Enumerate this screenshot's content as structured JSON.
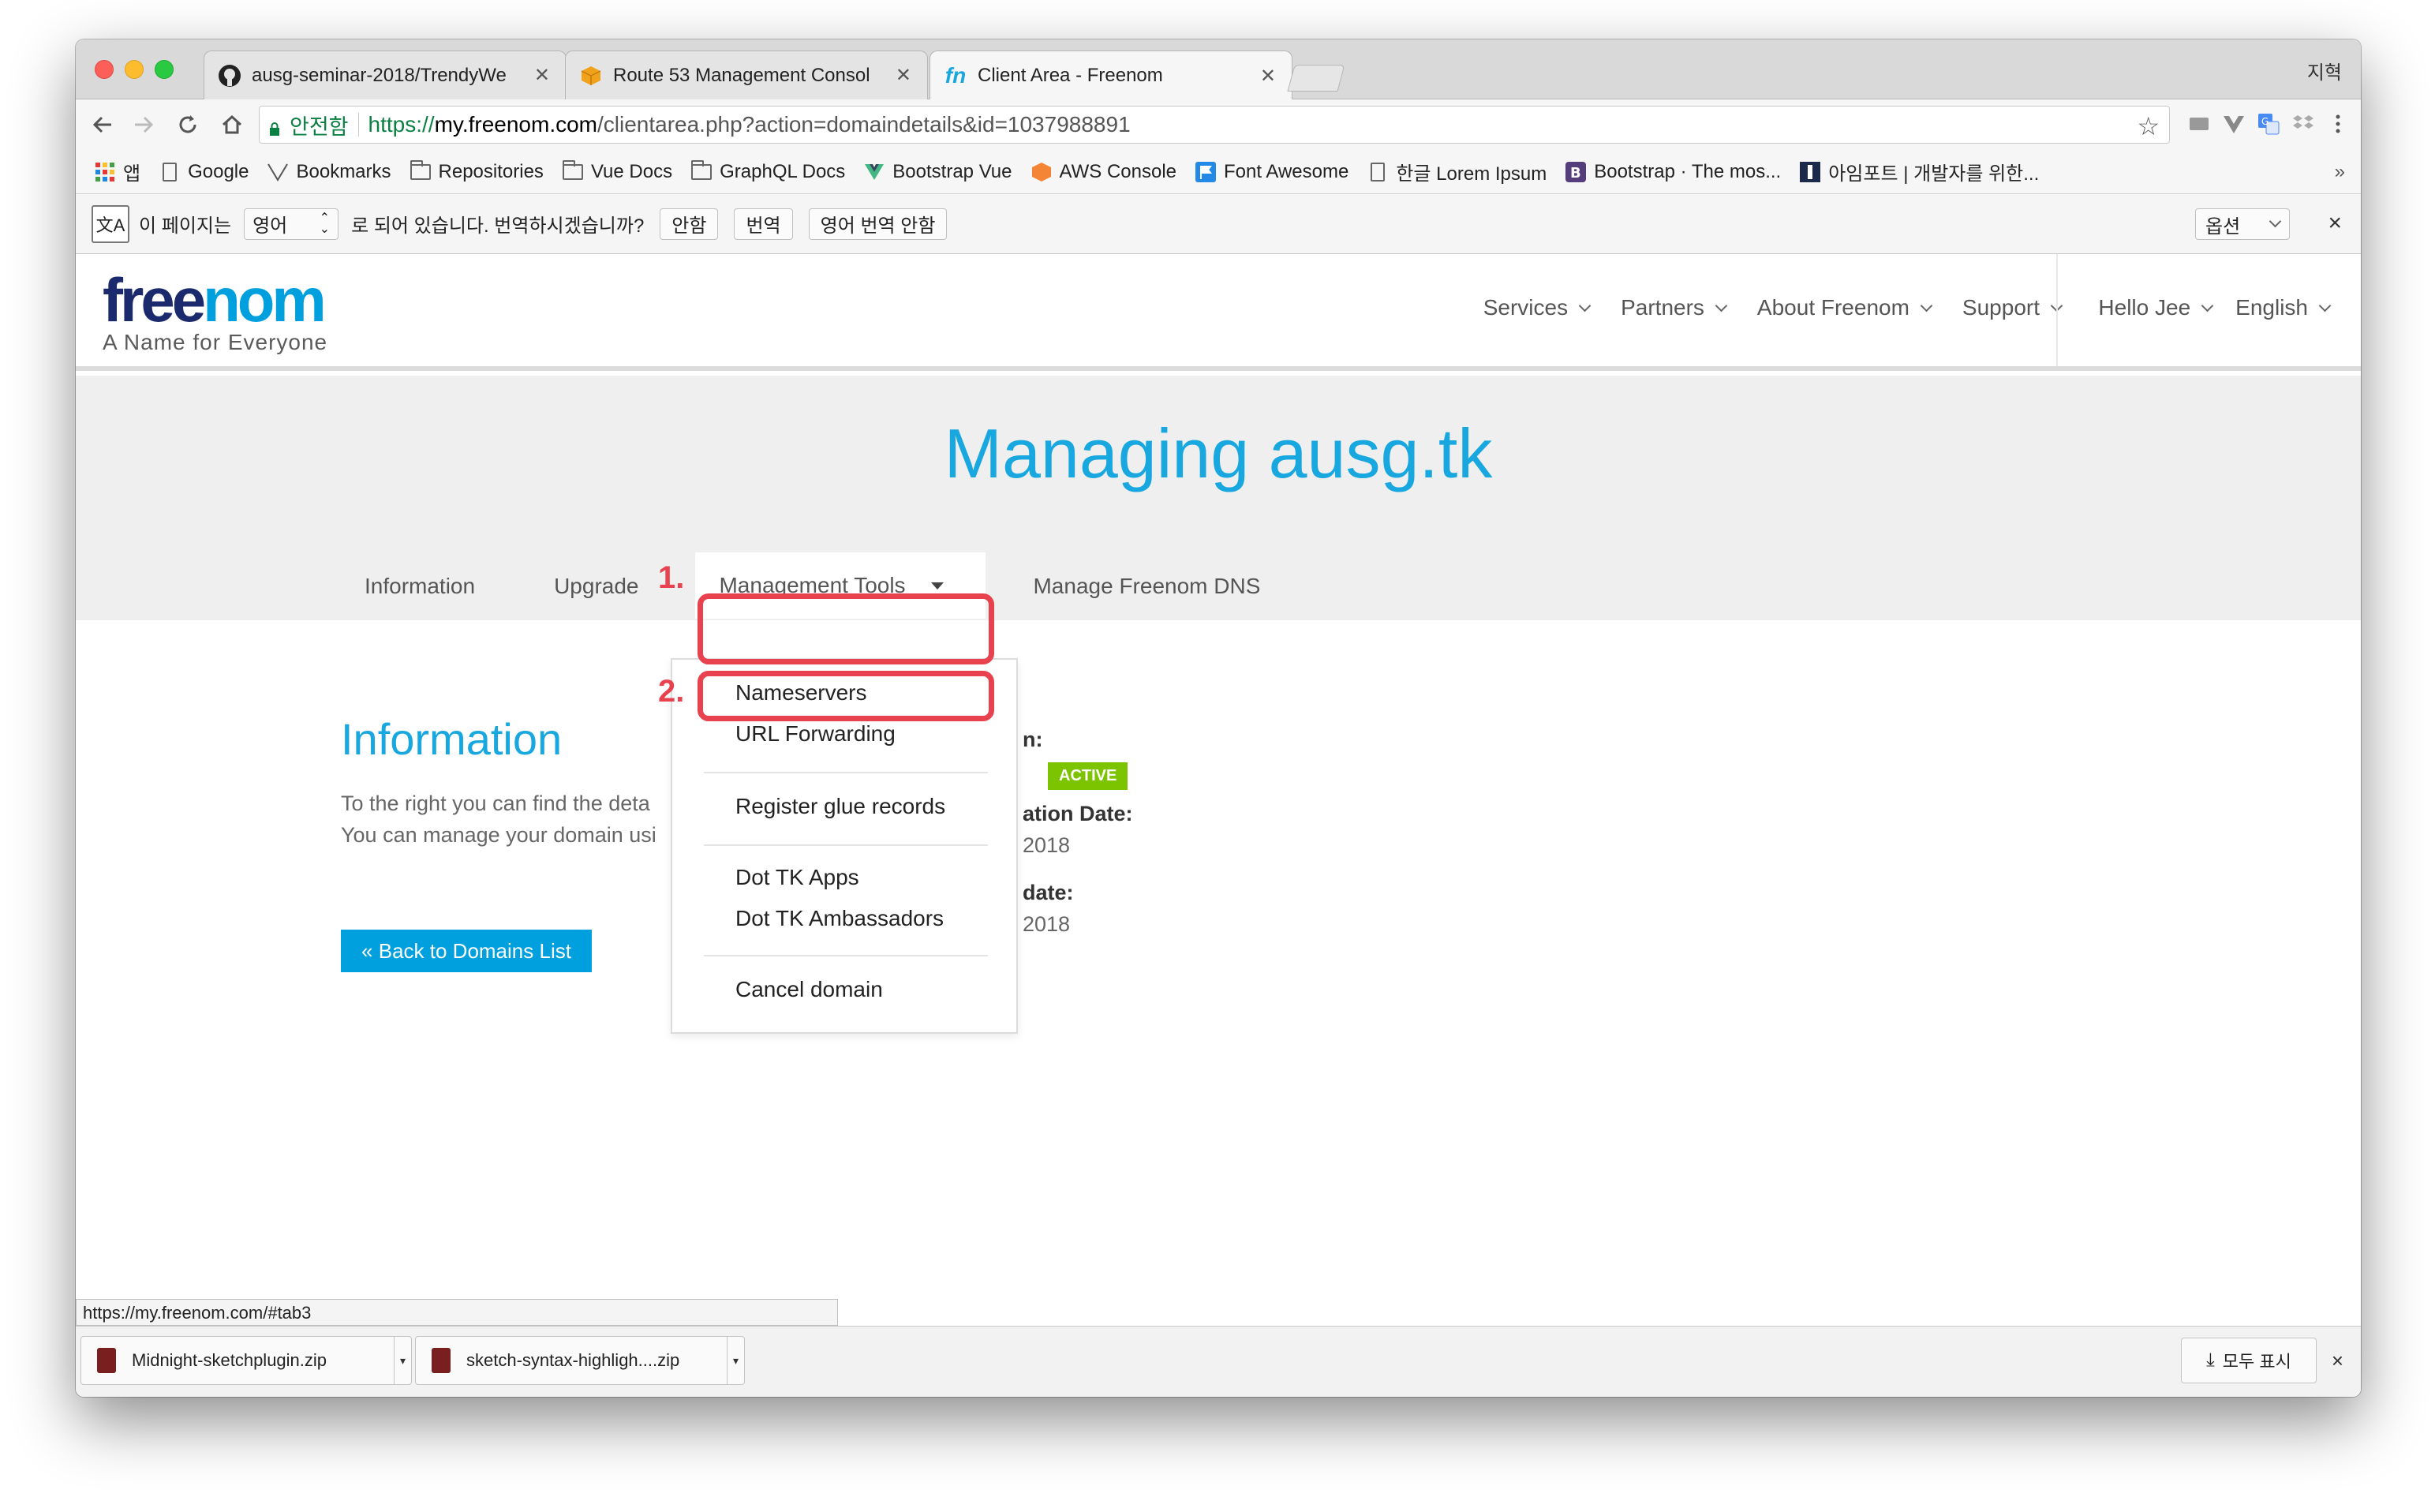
{
  "browser": {
    "tabs": [
      {
        "title": "ausg-seminar-2018/TrendyWe",
        "icon": "github-icon"
      },
      {
        "title": "Route 53 Management Consol",
        "icon": "aws-icon"
      },
      {
        "title": "Client Area - Freenom",
        "icon": "freenom-icon",
        "active": true
      }
    ],
    "profile": "지혁",
    "secure_label": "안전함",
    "url_scheme": "https://",
    "url_host": "my.freenom.com",
    "url_path": "/clientarea.php?action=domaindetails&id=1037988891"
  },
  "bookmarks": [
    {
      "label": "앱",
      "icon": "apps-icon"
    },
    {
      "label": "Google",
      "icon": "page-icon"
    },
    {
      "label": "Bookmarks",
      "icon": "vue-icon"
    },
    {
      "label": "Repositories",
      "icon": "folder-icon"
    },
    {
      "label": "Vue Docs",
      "icon": "folder-icon"
    },
    {
      "label": "GraphQL Docs",
      "icon": "folder-icon"
    },
    {
      "label": "Bootstrap Vue",
      "icon": "vue-icon"
    },
    {
      "label": "AWS Console",
      "icon": "aws-icon"
    },
    {
      "label": "Font Awesome",
      "icon": "flag-icon"
    },
    {
      "label": "한글 Lorem Ipsum",
      "icon": "page-icon"
    },
    {
      "label": "Bootstrap · The mos...",
      "icon": "bootstrap-icon"
    },
    {
      "label": "아임포트 | 개발자를 위한...",
      "icon": "iamport-icon"
    }
  ],
  "bookmarks_more": "»",
  "translate": {
    "prefix": "이 페이지는",
    "language": "영어",
    "question": "로 되어 있습니다. 번역하시겠습니까?",
    "no_button": "안함",
    "translate_button": "번역",
    "never_button": "영어 번역 안함",
    "options": "옵션"
  },
  "site": {
    "logo_free": "free",
    "logo_nom": "nom",
    "tagline": "A Name for Everyone",
    "nav": [
      "Services",
      "Partners",
      "About Freenom",
      "Support"
    ],
    "user_nav": [
      "Hello Jee",
      "English"
    ],
    "page_title": "Managing ausg.tk",
    "subnav": {
      "information": "Information",
      "upgrade": "Upgrade",
      "management_tools": "Management Tools",
      "manage_dns": "Manage Freenom DNS"
    },
    "dropdown": [
      "Nameservers",
      "URL Forwarding",
      "Register glue records",
      "Dot TK Apps",
      "Dot TK Ambassadors",
      "Cancel domain"
    ],
    "info_title": "Information",
    "info_text_line1": "To the right you can find the deta",
    "info_text_line2": "You can manage your domain usi",
    "back_button": "« Back to Domains List",
    "right_col": {
      "label1": "n:",
      "status": "ACTIVE",
      "label2": "ation Date:",
      "value2": "2018",
      "label3": "date:",
      "value3": "2018"
    }
  },
  "annotations": {
    "step1": "1.",
    "step2": "2.",
    "color": "#e8424e"
  },
  "status_url": "https://my.freenom.com/#tab3",
  "downloads": {
    "items": [
      "Midnight-sketchplugin.zip",
      "sketch-syntax-highligh....zip"
    ],
    "show_all": "모두 표시"
  },
  "colors": {
    "brand_blue": "#19a7e0",
    "brand_navy": "#1a2a6c",
    "active_green": "#7cc400"
  }
}
